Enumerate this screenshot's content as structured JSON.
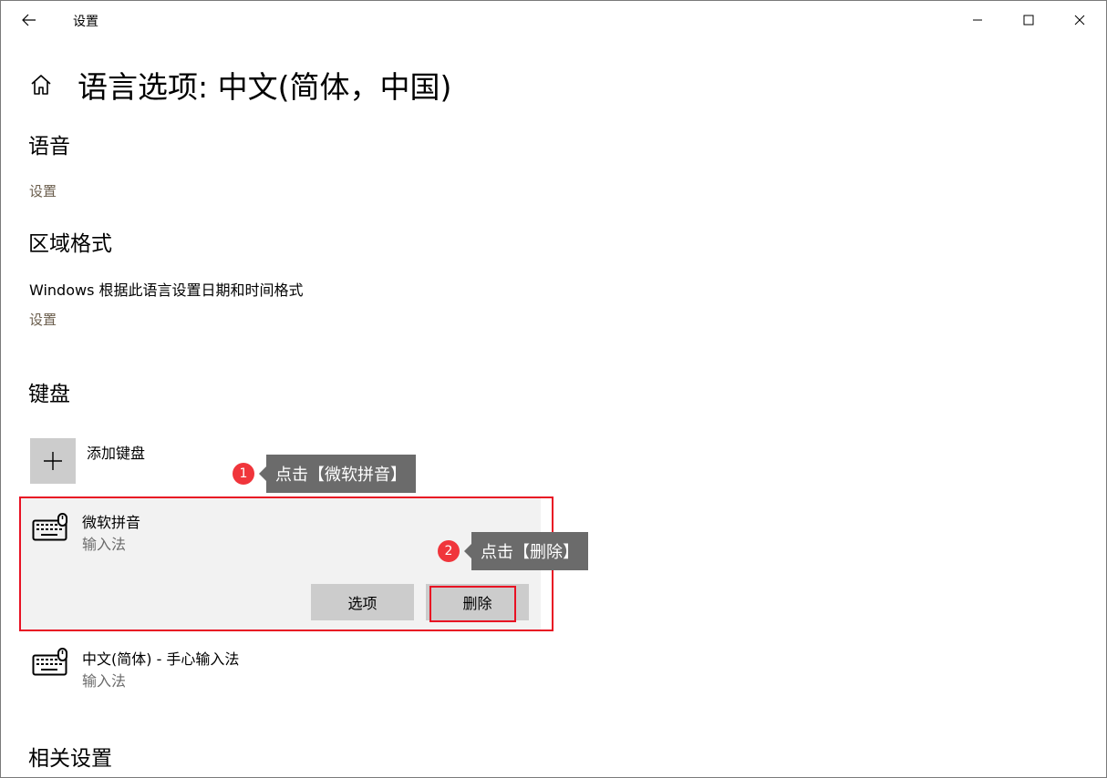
{
  "window": {
    "title": "设置"
  },
  "page": {
    "title": "语言选项: 中文(简体，中国)"
  },
  "speech": {
    "heading": "语音",
    "settings_link": "设置"
  },
  "region_format": {
    "heading": "区域格式",
    "description": "Windows 根据此语言设置日期和时间格式",
    "settings_link": "设置"
  },
  "keyboards": {
    "heading": "键盘",
    "add_label": "添加键盘",
    "items": [
      {
        "name": "微软拼音",
        "type": "输入法",
        "selected": true,
        "options_label": "选项",
        "remove_label": "删除"
      },
      {
        "name": "中文(简体) - 手心输入法",
        "type": "输入法",
        "selected": false
      }
    ]
  },
  "related": {
    "heading": "相关设置"
  },
  "annotations": {
    "step1": {
      "number": "1",
      "text": "点击【微软拼音】"
    },
    "step2": {
      "number": "2",
      "text": "点击【删除】"
    }
  },
  "colors": {
    "highlight_red": "#e81123",
    "badge_red": "#f0353b",
    "tooltip_bg": "#6b6b6b",
    "selected_bg": "#f2f2f2",
    "button_bg": "#cccccc",
    "link_color": "#6b5e4d"
  },
  "icons": {
    "back": "arrow-left-icon",
    "home": "home-icon",
    "minimize": "minimize-icon",
    "maximize": "maximize-icon",
    "close": "close-icon",
    "add": "plus-icon",
    "keyboard": "keyboard-icon"
  }
}
